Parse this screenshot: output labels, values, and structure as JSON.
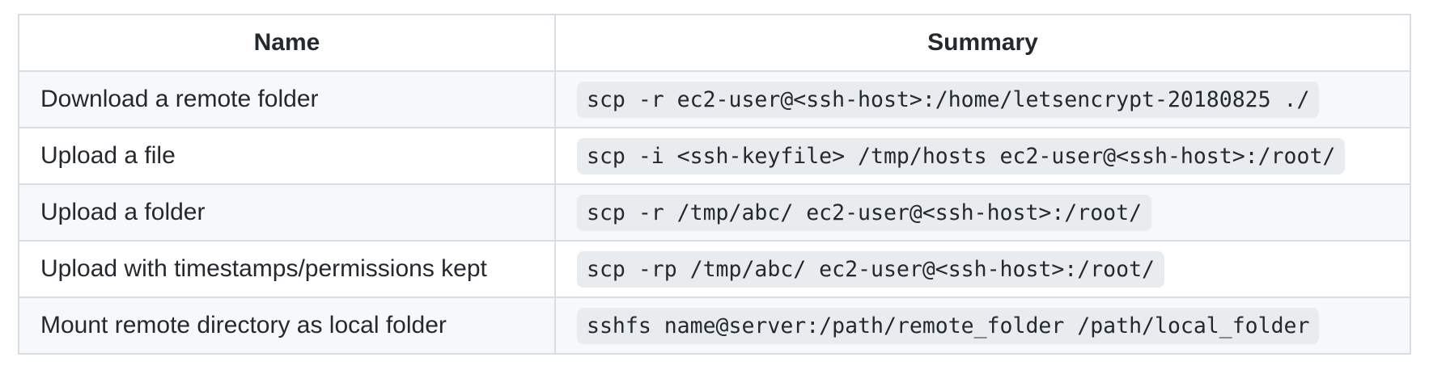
{
  "table": {
    "headers": {
      "name": "Name",
      "summary": "Summary"
    },
    "rows": [
      {
        "name": "Download a remote folder",
        "summary": "scp -r ec2-user@<ssh-host>:/home/letsencrypt-20180825 ./"
      },
      {
        "name": "Upload a file",
        "summary": "scp -i <ssh-keyfile> /tmp/hosts ec2-user@<ssh-host>:/root/"
      },
      {
        "name": "Upload a folder",
        "summary": "scp -r /tmp/abc/ ec2-user@<ssh-host>:/root/"
      },
      {
        "name": "Upload with timestamps/permissions kept",
        "summary": "scp -rp /tmp/abc/ ec2-user@<ssh-host>:/root/"
      },
      {
        "name": "Mount remote directory as local folder",
        "summary": "sshfs name@server:/path/remote_folder /path/local_folder"
      }
    ]
  },
  "colors": {
    "border": "#d8dee4",
    "alt_row_background": "#f6f8fa",
    "code_background": "#e9ecef",
    "text": "#24292f"
  }
}
